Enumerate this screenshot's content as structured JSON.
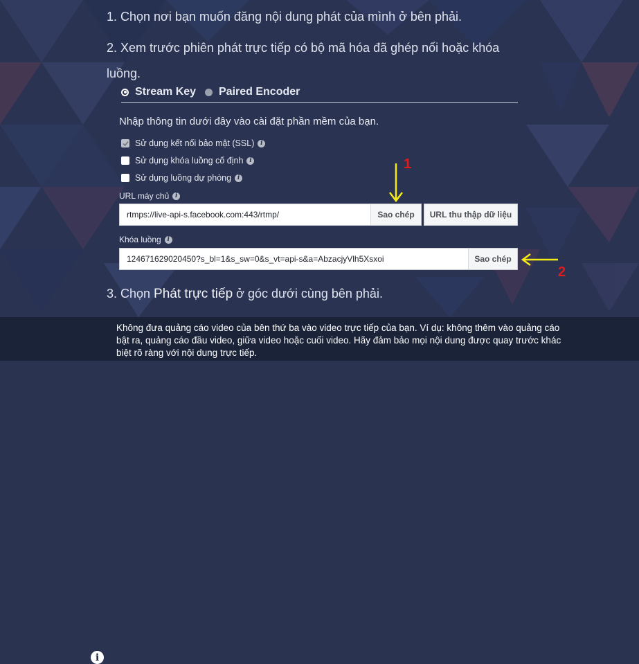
{
  "steps": {
    "step1": "1. Chọn nơi bạn muốn đăng nội dung phát của mình ở bên phải.",
    "step2": "2. Xem trước phiên phát trực tiếp có bộ mã hóa đã ghép nối hoặc khóa luồng.",
    "step3_prefix": "3. Chọn ",
    "step3_strong": "Phát trực tiếp",
    "step3_suffix": " ở góc dưới cùng bên phải."
  },
  "tabs": [
    {
      "label": "Stream Key",
      "selected": true
    },
    {
      "label": "Paired Encoder",
      "selected": false
    }
  ],
  "intro": "Nhập thông tin dưới đây vào cài đặt phần mềm của bạn.",
  "options": [
    {
      "label": "Sử dụng kết nối bảo mật (SSL)",
      "checked": true
    },
    {
      "label": "Sử dụng khóa luồng cố định",
      "checked": false
    },
    {
      "label": "Sử dụng luồng dự phòng",
      "checked": false
    }
  ],
  "server": {
    "label": "URL máy chủ",
    "value": "rtmps://live-api-s.facebook.com:443/rtmp/",
    "copy_label": "Sao chép",
    "ingest_label": "URL thu thập dữ liệu"
  },
  "stream_key": {
    "label": "Khóa luồng",
    "value": "124671629020450?s_bl=1&s_sw=0&s_vt=api-s&a=AbzacjyVlh5Xsxoi",
    "copy_label": "Sao chép"
  },
  "annotations": {
    "marker1": "1",
    "marker2": "2",
    "arrow_color": "#f5ea14",
    "marker_color": "#e01b1b"
  },
  "banner": {
    "icon": "info-icon",
    "text": "Không đưa quảng cáo video của bên thứ ba vào video trực tiếp của bạn. Ví dụ: không thêm vào quảng cáo bật ra, quảng cáo đầu video, giữa video hoặc cuối video. Hãy đảm bảo mọi nội dung được quay trước khác biệt rõ ràng với nội dung trực tiếp."
  },
  "colors": {
    "background": "#2a3350",
    "banner": "#1b2339",
    "text": "#e6e9ef"
  }
}
